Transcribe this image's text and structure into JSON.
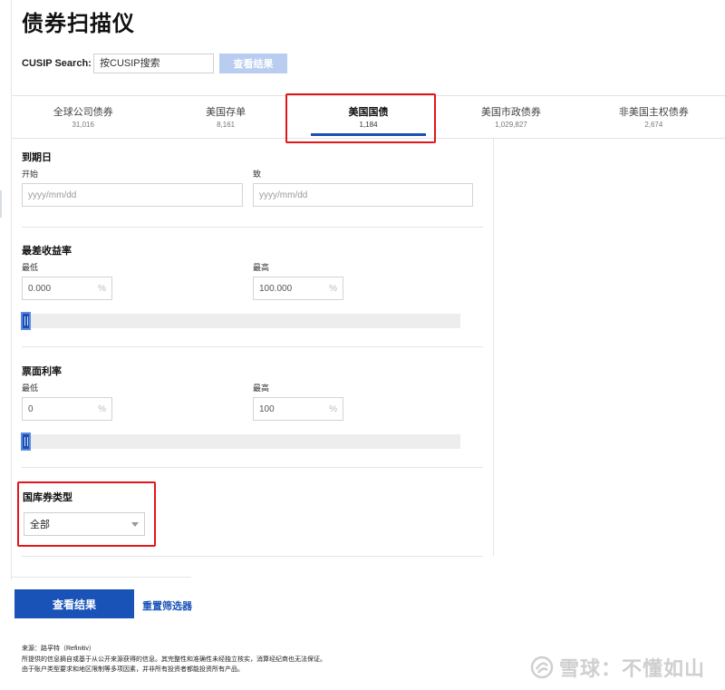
{
  "page_title": "债券扫描仪",
  "search": {
    "label": "CUSIP Search:",
    "placeholder": "按CUSIP搜索",
    "button_label": "查看结果"
  },
  "tabs": [
    {
      "label": "全球公司债券",
      "count": "31,016",
      "active": false
    },
    {
      "label": "美国存单",
      "count": "8,161",
      "active": false
    },
    {
      "label": "美国国债",
      "count": "1,184",
      "active": true
    },
    {
      "label": "美国市政债券",
      "count": "1,029,827",
      "active": false
    },
    {
      "label": "非美国主权债券",
      "count": "2,674",
      "active": false
    }
  ],
  "maturity": {
    "title": "到期日",
    "start_label": "开始",
    "end_label": "致",
    "start_placeholder": "yyyy/mm/dd",
    "end_placeholder": "yyyy/mm/dd"
  },
  "worst_yield": {
    "title": "最差收益率",
    "min_label": "最低",
    "max_label": "最高",
    "min_value": "0.000",
    "max_value": "100.000",
    "unit": "%",
    "slider_level": 0
  },
  "coupon_rate": {
    "title": "票面利率",
    "min_label": "最低",
    "max_label": "最高",
    "min_value": "0",
    "max_value": "100",
    "unit": "%",
    "slider_level": 0
  },
  "treasury_type": {
    "title": "国库券类型",
    "selected": "全部"
  },
  "actions": {
    "view_results": "查看结果",
    "reset_filters": "重置筛选器"
  },
  "disclaimer": {
    "source": "来源：路孚特（Refinitiv）",
    "line1": "所提供的信息摘自或基于从公开来源获得的信息。其完整性和准确性未经独立核实，消算经纪商也无法保证。",
    "line2": "由于账户类型要求和地区限制等多项因素，并非所有投资者都能投资所有产品。"
  },
  "watermark": "雪球：不懂如山",
  "colors": {
    "accent": "#1b4fb3",
    "highlight_box": "#e3161c",
    "disabled_button": "#b9cdf0"
  }
}
